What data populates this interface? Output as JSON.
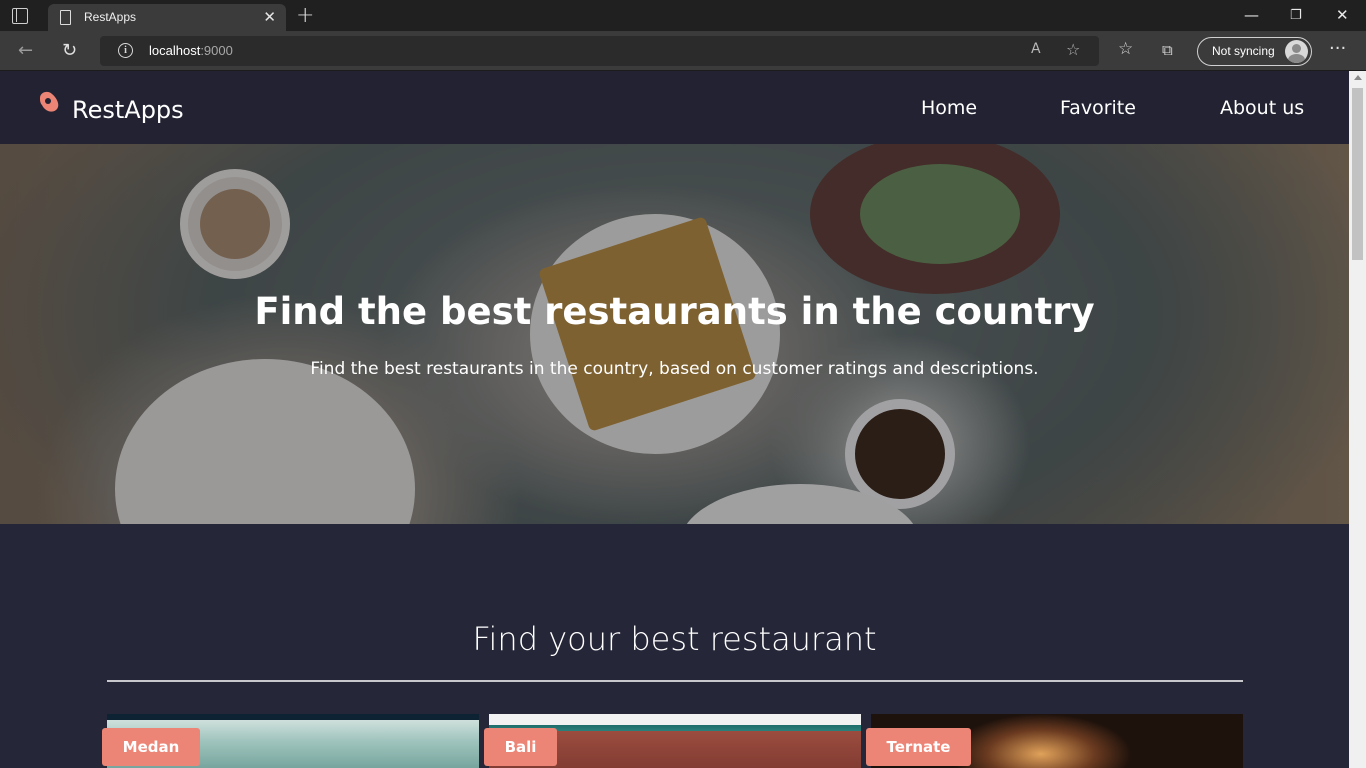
{
  "browser": {
    "tab_title": "RestApps",
    "url_host": "localhost",
    "url_port": ":9000",
    "sync_label": "Not syncing"
  },
  "site": {
    "brand": "RestApps",
    "accent_color": "#ec8575",
    "nav": [
      {
        "label": "Home"
      },
      {
        "label": "Favorite"
      },
      {
        "label": "About us"
      }
    ]
  },
  "hero": {
    "title": "Find the best restaurants in the country",
    "subtitle": "Find the best restaurants in the country, based on customer ratings and descriptions."
  },
  "content": {
    "section_title": "Find your best restaurant",
    "restaurants": [
      {
        "city": "Medan"
      },
      {
        "city": "Bali"
      },
      {
        "city": "Ternate"
      }
    ]
  }
}
